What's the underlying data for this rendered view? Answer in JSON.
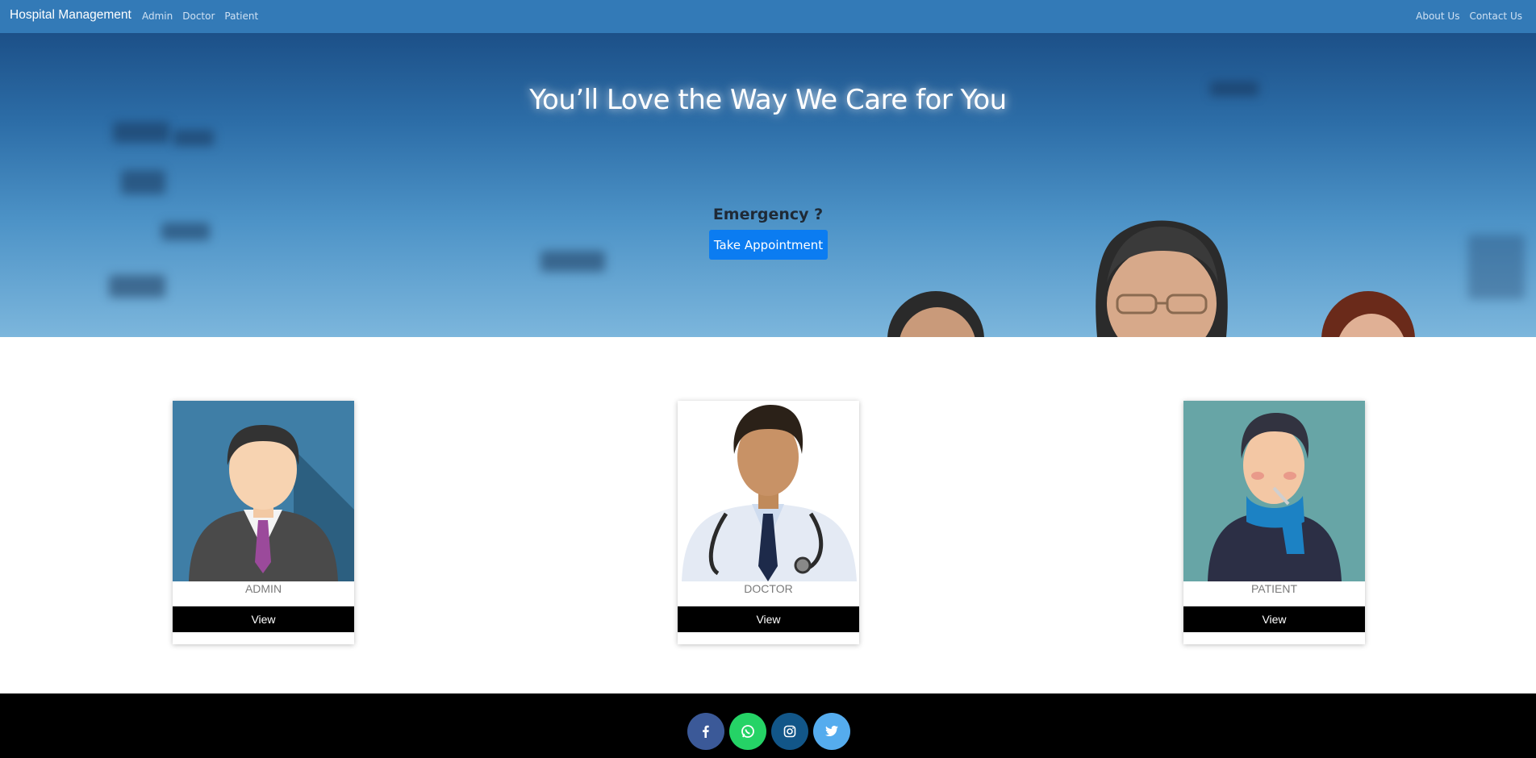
{
  "navbar": {
    "brand": "Hospital Management",
    "left_links": [
      "Admin",
      "Doctor",
      "Patient"
    ],
    "right_links": [
      "About Us",
      "Contact Us"
    ],
    "color": "#337ab7"
  },
  "hero": {
    "title": "You’ll Love the Way We Care for You",
    "emergency_text": "Emergency ?",
    "appointment_button": "Take Appointment",
    "button_color": "#0b7cf1"
  },
  "cards": [
    {
      "label": "ADMIN",
      "button": "View",
      "icon": "admin-avatar"
    },
    {
      "label": "DOCTOR",
      "button": "View",
      "icon": "doctor-avatar"
    },
    {
      "label": "PATIENT",
      "button": "View",
      "icon": "patient-avatar"
    }
  ],
  "footer": {
    "socials": [
      {
        "name": "facebook-icon",
        "color": "#3b5998"
      },
      {
        "name": "whatsapp-icon",
        "color": "#25d366"
      },
      {
        "name": "instagram-icon",
        "color": "#125688"
      },
      {
        "name": "twitter-icon",
        "color": "#55acee"
      }
    ]
  }
}
